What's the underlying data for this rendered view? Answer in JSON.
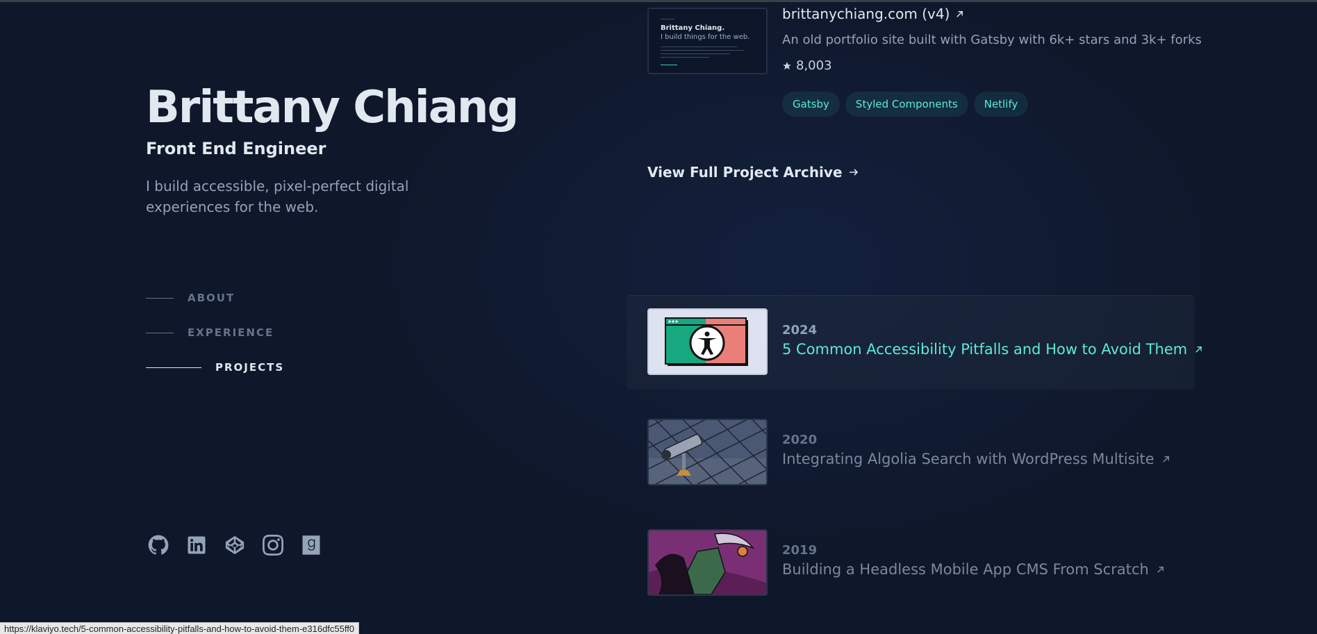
{
  "profile": {
    "name": "Brittany Chiang",
    "role": "Front End Engineer",
    "tagline": "I build accessible, pixel-perfect digital experiences for the web."
  },
  "nav": {
    "items": [
      {
        "label": "ABOUT",
        "active": false
      },
      {
        "label": "EXPERIENCE",
        "active": false
      },
      {
        "label": "PROJECTS",
        "active": true
      }
    ]
  },
  "socials": [
    "github-icon",
    "linkedin-icon",
    "codepen-icon",
    "instagram-icon",
    "goodreads-icon"
  ],
  "project": {
    "title": "brittanychiang.com (v4)",
    "description": "An old portfolio site built with Gatsby with 6k+ stars and 3k+ forks",
    "stars": "8,003",
    "tags": [
      "Gatsby",
      "Styled Components",
      "Netlify"
    ],
    "thumb_name": "Brittany Chiang.",
    "thumb_sub": "I build things for the web."
  },
  "archive_link": "View Full Project Archive",
  "writing": [
    {
      "year": "2024",
      "title": "5 Common Accessibility Pitfalls and How to Avoid Them"
    },
    {
      "year": "2020",
      "title": "Integrating Algolia Search with WordPress Multisite"
    },
    {
      "year": "2019",
      "title": "Building a Headless Mobile App CMS From Scratch"
    }
  ],
  "status_url": "https://klaviyo.tech/5-common-accessibility-pitfalls-and-how-to-avoid-them-e316dfc55ff0",
  "colors": {
    "background": "#0f172a",
    "accent": "#5eead4",
    "heading": "#e2e8f0",
    "body": "#94a3b8"
  }
}
